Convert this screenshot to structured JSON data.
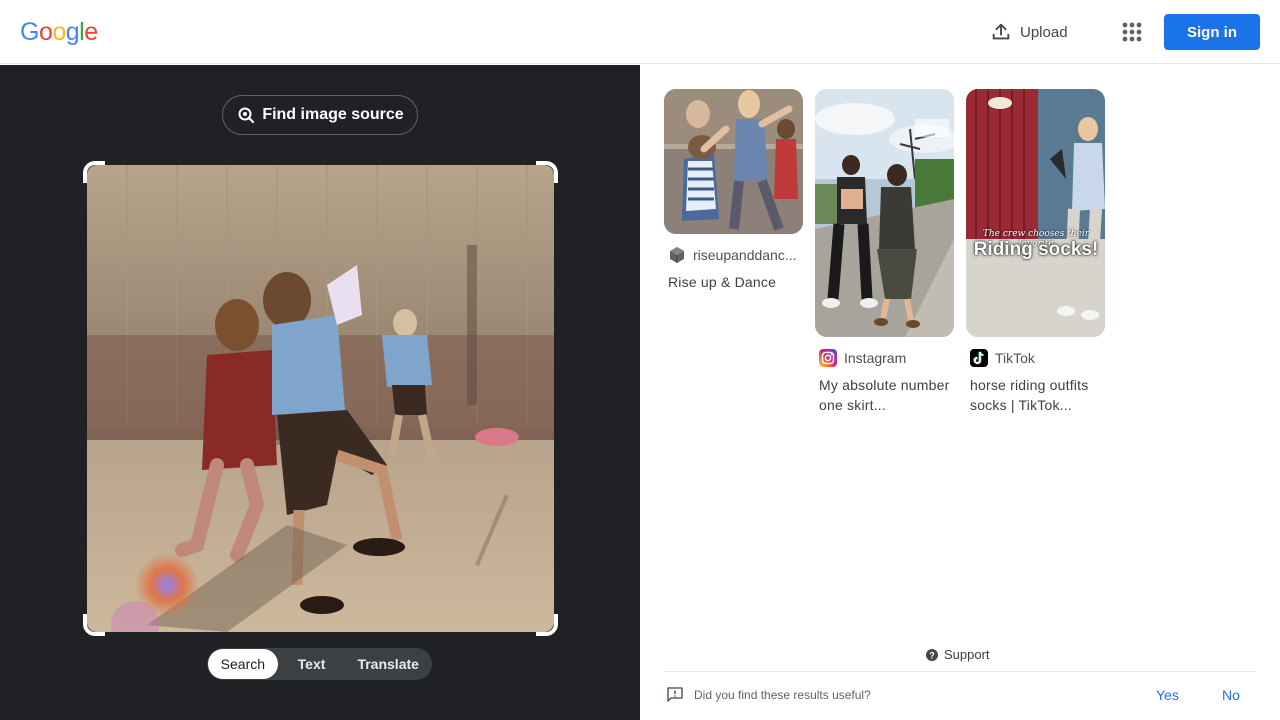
{
  "header": {
    "logo_letters": [
      {
        "ch": "G",
        "color": "#4285F4"
      },
      {
        "ch": "o",
        "color": "#EA4335"
      },
      {
        "ch": "o",
        "color": "#FBBC05"
      },
      {
        "ch": "g",
        "color": "#4285F4"
      },
      {
        "ch": "l",
        "color": "#34A853"
      },
      {
        "ch": "e",
        "color": "#EA4335"
      }
    ],
    "upload_label": "Upload",
    "upload_icon": "upload-icon",
    "apps_icon": "apps-grid-icon",
    "signin_label": "Sign in"
  },
  "lens": {
    "find_source_label": "Find image source",
    "find_source_icon": "lens-search-icon",
    "modes": [
      {
        "label": "Search",
        "active": true
      },
      {
        "label": "Text",
        "active": false
      },
      {
        "label": "Translate",
        "active": false
      }
    ]
  },
  "results": [
    {
      "source": "riseupanddanc...",
      "source_icon": "cube-icon",
      "title": "Rise up & Dance"
    },
    {
      "source": "Instagram",
      "source_icon": "instagram-icon",
      "title": "My absolute number one skirt..."
    },
    {
      "source": "TikTok",
      "source_icon": "tiktok-icon",
      "title": "horse riding outfits socks | TikTok...",
      "overlay_caption": "The crew chooses their favorite",
      "overlay_title": "Riding socks!"
    }
  ],
  "footer": {
    "support_label": "Support",
    "feedback_question": "Did you find these results useful?",
    "yes_label": "Yes",
    "no_label": "No"
  },
  "colors": {
    "accent": "#1a73e8",
    "dark_panel": "#202124"
  }
}
